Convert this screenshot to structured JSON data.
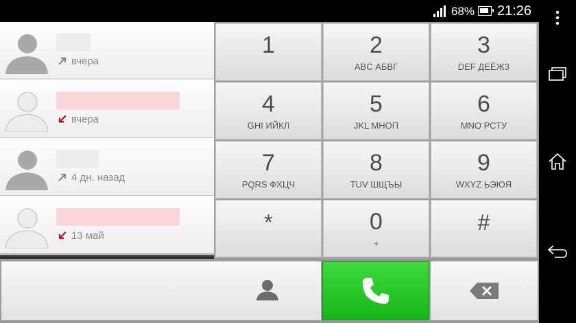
{
  "status_bar": {
    "battery_percent": "68%",
    "time": "21:26",
    "icons": [
      "signal-icon",
      "battery-charging-icon"
    ]
  },
  "call_log": [
    {
      "time": "вчера",
      "direction": "outgoing",
      "name_tint": "#ececec"
    },
    {
      "time": "вчера",
      "direction": "missed",
      "name_tint": "#fbd6d9"
    },
    {
      "time": "4 дн. назад",
      "direction": "outgoing",
      "name_tint": "#ececec"
    },
    {
      "time": "13 май",
      "direction": "missed",
      "name_tint": "#fbd6d9"
    }
  ],
  "dialpad": {
    "keys": [
      {
        "digit": "1",
        "letters": ""
      },
      {
        "digit": "2",
        "letters": "ABC АБВГ"
      },
      {
        "digit": "3",
        "letters": "DEF ДЕЁЖЗ"
      },
      {
        "digit": "4",
        "letters": "GHI ИЙКЛ"
      },
      {
        "digit": "5",
        "letters": "JKL МНОП"
      },
      {
        "digit": "6",
        "letters": "MNO РСТУ"
      },
      {
        "digit": "7",
        "letters": "PQRS ФХЦЧ"
      },
      {
        "digit": "8",
        "letters": "TUV ШЩЪЫ"
      },
      {
        "digit": "9",
        "letters": "WXYZ ЬЭЮЯ"
      },
      {
        "digit": "*",
        "letters": ""
      },
      {
        "digit": "0",
        "letters": "+"
      },
      {
        "digit": "#",
        "letters": ""
      }
    ]
  },
  "action_bar": {
    "number_value": "",
    "icons": [
      "contact-icon",
      "phone-icon",
      "backspace-icon"
    ]
  },
  "colors": {
    "call_button": "#22c322",
    "missed_arrow": "#b0141c",
    "outgoing_arrow": "#8a8a8a"
  }
}
